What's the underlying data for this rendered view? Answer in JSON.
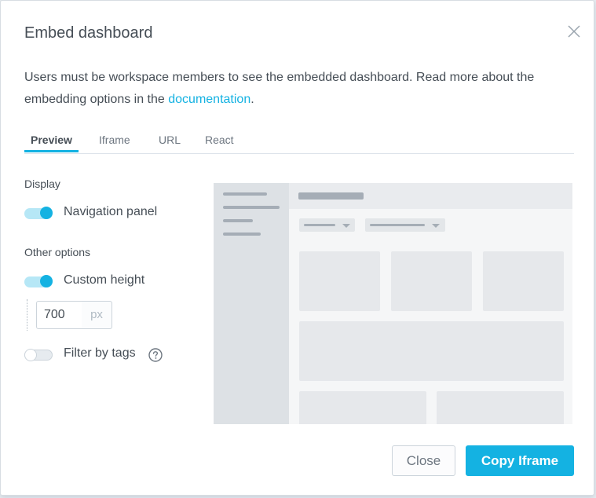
{
  "dialog": {
    "title": "Embed dashboard",
    "description_prefix": "Users must be workspace members to see the embedded dashboard. Read more about the embedding options in the ",
    "description_link": "documentation",
    "description_suffix": "."
  },
  "tabs": [
    {
      "label": "Preview",
      "active": true
    },
    {
      "label": "Iframe",
      "active": false
    },
    {
      "label": "URL",
      "active": false
    },
    {
      "label": "React",
      "active": false
    }
  ],
  "display": {
    "section_label": "Display",
    "navigation_panel": {
      "label": "Navigation panel",
      "on": true
    }
  },
  "other_options": {
    "section_label": "Other options",
    "custom_height": {
      "label": "Custom height",
      "on": true,
      "value": "700",
      "unit": "px"
    },
    "filter_by_tags": {
      "label": "Filter by tags",
      "on": false,
      "help_icon": "question-circle-icon"
    }
  },
  "footer": {
    "close_label": "Close",
    "primary_label": "Copy Iframe"
  },
  "colors": {
    "accent": "#14b2e2",
    "text": "#464e56",
    "preview_bg": "#f5f6f7"
  }
}
